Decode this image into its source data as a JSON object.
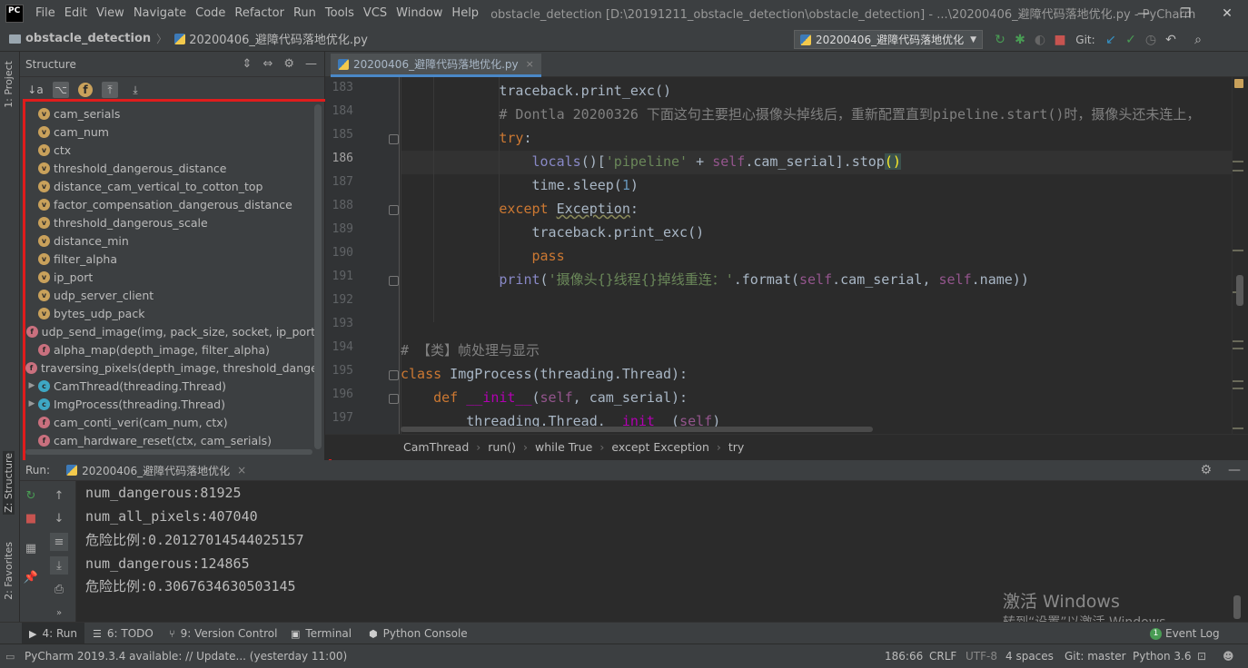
{
  "titlebar": {
    "logo": "PC",
    "menus": [
      "File",
      "Edit",
      "View",
      "Navigate",
      "Code",
      "Refactor",
      "Run",
      "Tools",
      "VCS",
      "Window",
      "Help"
    ],
    "window_title": "obstacle_detection [D:\\20191211_obstacle_detection\\obstacle_detection] - ...\\20200406_避障代码落地优化.py - PyCharm",
    "controls": {
      "minimize": "—",
      "restore": "❐",
      "close": "✕"
    }
  },
  "navbar": {
    "project": "obstacle_detection",
    "file": "20200406_避障代码落地优化.py",
    "run_config": "20200406_避障代码落地优化",
    "git_label": "Git:"
  },
  "left_stripe": {
    "project_tab": "1: Project",
    "structure_tab": "Z: Structure",
    "favorites_tab": "2: Favorites"
  },
  "structure": {
    "title": "Structure",
    "items": [
      {
        "kind": "v",
        "label": "cam_serials",
        "expandable": false
      },
      {
        "kind": "v",
        "label": "cam_num",
        "expandable": false
      },
      {
        "kind": "v",
        "label": "ctx",
        "expandable": false
      },
      {
        "kind": "v",
        "label": "threshold_dangerous_distance",
        "expandable": false
      },
      {
        "kind": "v",
        "label": "distance_cam_vertical_to_cotton_top",
        "expandable": false
      },
      {
        "kind": "v",
        "label": "factor_compensation_dangerous_distance",
        "expandable": false
      },
      {
        "kind": "v",
        "label": "threshold_dangerous_scale",
        "expandable": false
      },
      {
        "kind": "v",
        "label": "distance_min",
        "expandable": false
      },
      {
        "kind": "v",
        "label": "filter_alpha",
        "expandable": false
      },
      {
        "kind": "v",
        "label": "ip_port",
        "expandable": false
      },
      {
        "kind": "v",
        "label": "udp_server_client",
        "expandable": false
      },
      {
        "kind": "v",
        "label": "bytes_udp_pack",
        "expandable": false
      },
      {
        "kind": "f",
        "label": "udp_send_image(img, pack_size, socket, ip_port)",
        "expandable": false
      },
      {
        "kind": "f",
        "label": "alpha_map(depth_image, filter_alpha)",
        "expandable": false
      },
      {
        "kind": "f",
        "label": "traversing_pixels(depth_image, threshold_dangerou",
        "expandable": false
      },
      {
        "kind": "c",
        "label": "CamThread(threading.Thread)",
        "expandable": true
      },
      {
        "kind": "c",
        "label": "ImgProcess(threading.Thread)",
        "expandable": true
      },
      {
        "kind": "f",
        "label": "cam_conti_veri(cam_num, ctx)",
        "expandable": false
      },
      {
        "kind": "f",
        "label": "cam_hardware_reset(ctx, cam_serials)",
        "expandable": false
      }
    ]
  },
  "editor": {
    "tab_label": "20200406_避障代码落地优化.py",
    "tab_close": "×",
    "line_numbers": [
      "183",
      "184",
      "185",
      "186",
      "187",
      "188",
      "189",
      "190",
      "191",
      "192",
      "193",
      "194",
      "195",
      "196",
      "197"
    ],
    "current_line": "186",
    "breadcrumbs": [
      "CamThread",
      "run()",
      "while True",
      "except Exception",
      "try"
    ]
  },
  "run": {
    "label": "Run:",
    "config": "20200406_避障代码落地优化",
    "output": [
      "num_dangerous:81925",
      "num_all_pixels:407040",
      "危险比例:0.20127014544025157",
      "num_dangerous:124865",
      "危险比例:0.3067634630503145"
    ]
  },
  "activation": {
    "line1": "激活 Windows",
    "line2": "转到“设置”以激活 Windows。"
  },
  "tool_tabs": [
    {
      "icon": "▶",
      "label": "4: Run"
    },
    {
      "icon": "☰",
      "label": "6: TODO"
    },
    {
      "icon": "⑂",
      "label": "9: Version Control"
    },
    {
      "icon": "▣",
      "label": "Terminal"
    },
    {
      "icon": "⬢",
      "label": "Python Console"
    }
  ],
  "event_log": {
    "count": "1",
    "label": "Event Log"
  },
  "statusbar": {
    "message": "PyCharm 2019.3.4 available: // Update... (yesterday 11:00)",
    "position": "186:66",
    "line_sep": "CRLF",
    "encoding": "UTF-8",
    "indent": "4 spaces",
    "git": "Git: master",
    "interpreter": "Python 3.6"
  }
}
